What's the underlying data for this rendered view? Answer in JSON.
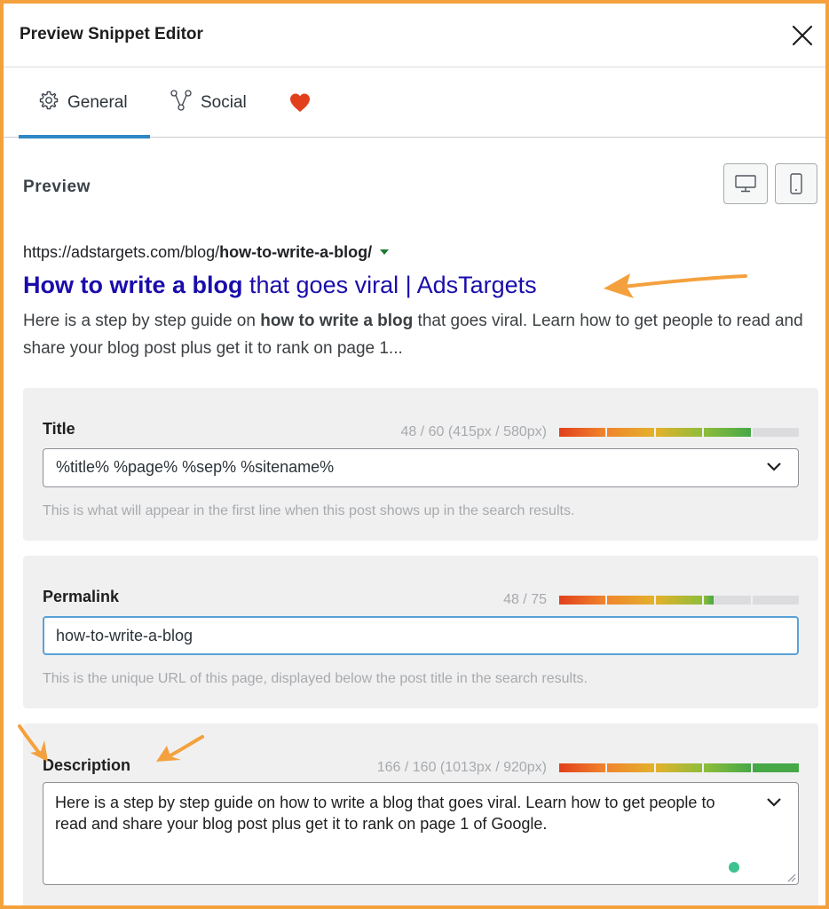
{
  "modal": {
    "title": "Preview Snippet Editor",
    "close_icon": "close-icon"
  },
  "tabs": [
    {
      "label": "General",
      "icon": "gear-icon",
      "active": true
    },
    {
      "label": "Social",
      "icon": "share-nodes-icon",
      "active": false
    },
    {
      "label": "",
      "icon": "heart-icon",
      "active": false
    }
  ],
  "preview": {
    "label": "Preview",
    "url_base": "https://adstargets.com/blog/",
    "url_slug": "how-to-write-a-blog/",
    "title_bold": "How to write a blog",
    "title_rest": " that goes viral | AdsTargets",
    "desc_pre": "Here is a step by step guide on ",
    "desc_bold": "how to write a blog",
    "desc_post": " that goes viral. Learn how to get people to read and share your blog post plus get it to rank on page 1..."
  },
  "fields": {
    "title": {
      "label": "Title",
      "counter": "48 / 60 (415px / 580px)",
      "value": "%title% %page% %sep% %sitename%",
      "help": "This is what will appear in the first line when this post shows up in the search results.",
      "meter_fraction": 0.8
    },
    "permalink": {
      "label": "Permalink",
      "counter": "48 / 75",
      "value": "how-to-write-a-blog",
      "help": "This is the unique URL of this page, displayed below the post title in the search results.",
      "meter_fraction": 0.64
    },
    "description": {
      "label": "Description",
      "counter": "166 / 160 (1013px / 920px)",
      "value": "Here is a step by step guide on how to write a blog that goes viral. Learn how to get people to read and share your blog post plus get it to rank on page 1 of Google.",
      "meter_fraction": 1.0
    }
  },
  "colors": {
    "accent": "#2e88c4",
    "heart": "#e2401c",
    "serp_title": "#1a0dab",
    "frame": "#f4a13d",
    "meter": [
      "#e2401c",
      "#f0852d",
      "#e3b12c",
      "#8fbd3b",
      "#46a847"
    ]
  }
}
